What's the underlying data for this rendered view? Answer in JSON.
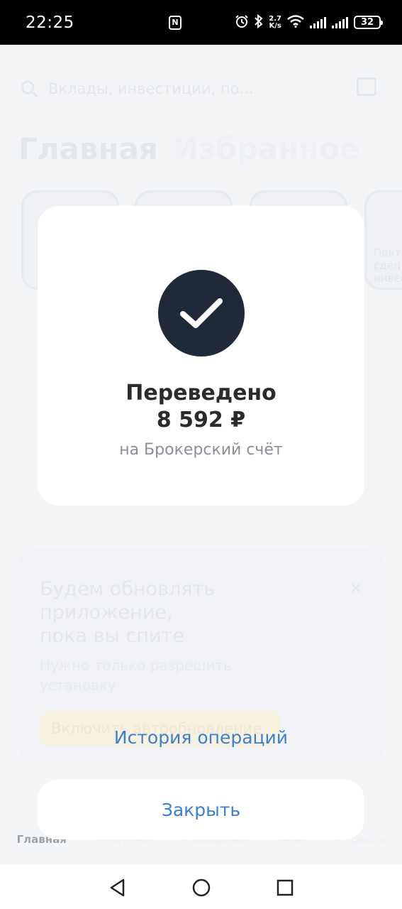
{
  "status_bar": {
    "time": "22:25",
    "nfc_label": "N",
    "speed_value": "2.7",
    "speed_unit": "K/s",
    "battery": "32"
  },
  "background_app": {
    "search_placeholder": "Вклады, инвестиции, по...",
    "tabs": [
      "Главная",
      "Избранное"
    ],
    "stories": [
      "...",
      "...",
      "...",
      "Повт... сдел... инвес..."
    ],
    "promo_card": {
      "title_lines": [
        "Будем обновлять",
        "приложение,",
        "пока вы спите"
      ],
      "text_lines": [
        "Нужно только разрешить",
        "установку"
      ],
      "button": "Включить автообновление"
    },
    "bottom_nav": [
      "Главная",
      "Платежи",
      "Сообщения",
      "Мой",
      "Сервисы"
    ]
  },
  "dialog": {
    "title": "Переведено",
    "amount": "8 592 ₽",
    "subtitle": "на Брокерский счёт"
  },
  "actions": {
    "history_label": "История операций",
    "close_label": "Закрыть"
  },
  "colors": {
    "accent_link": "#3d7fcf",
    "check_circle": "#1f2937"
  }
}
